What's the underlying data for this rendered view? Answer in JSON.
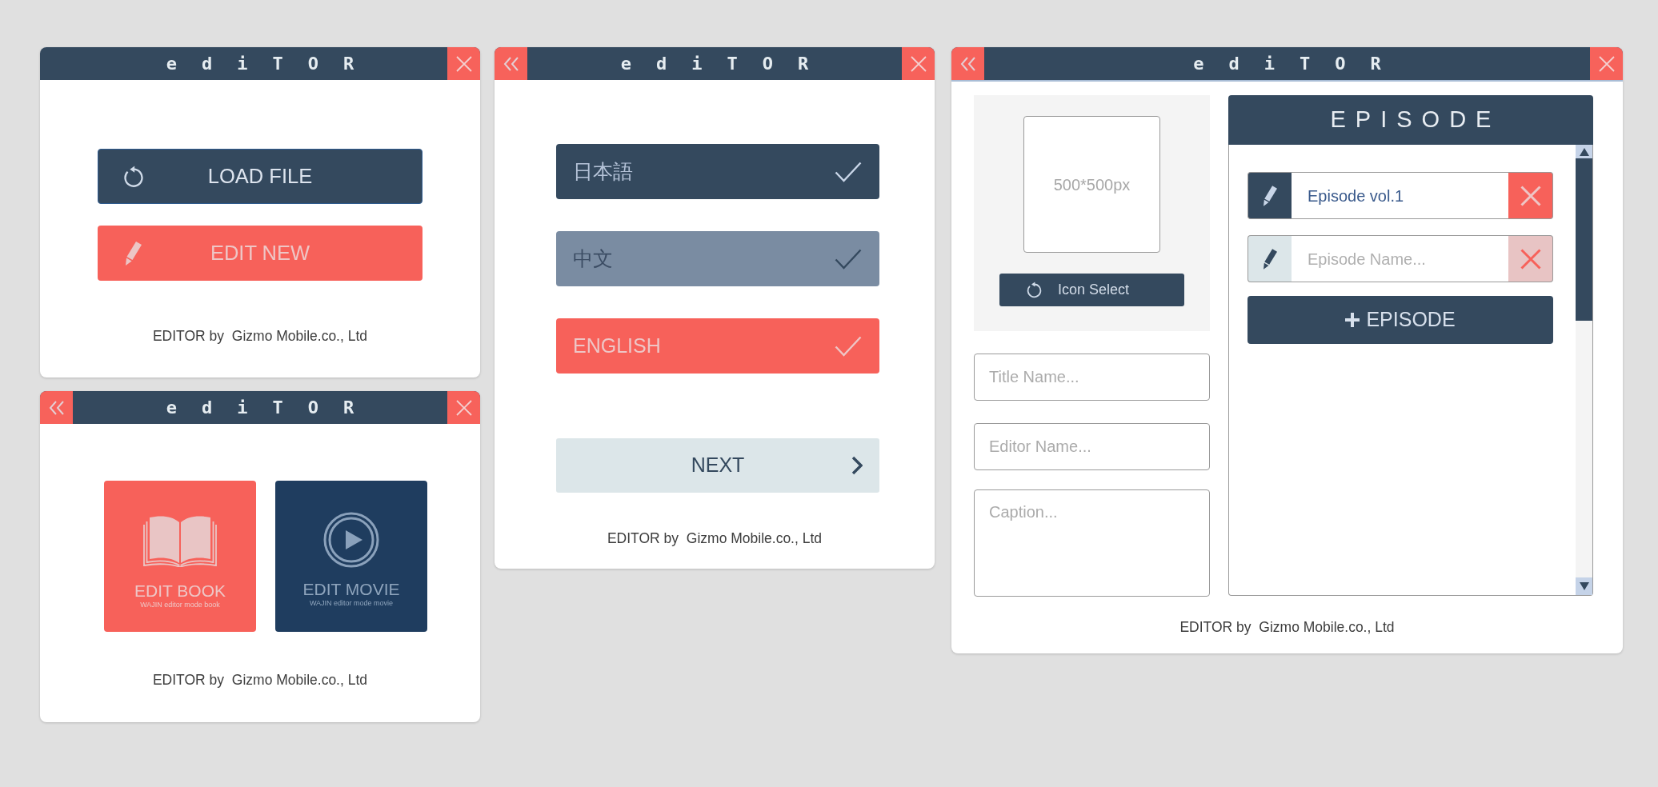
{
  "screens": [
    {
      "kind": "start",
      "title": "ediTOR",
      "back_button": false,
      "close_button": true,
      "actions": [
        {
          "label": "LOAD FILE",
          "kind": "load"
        },
        {
          "label": "EDIT NEW",
          "kind": "new"
        }
      ],
      "footer": "EDITOR by  Gizmo Mobile.co., Ltd"
    },
    {
      "kind": "mode",
      "title": "ediTOR",
      "back_button": true,
      "close_button": true,
      "modes": [
        {
          "label": "EDIT BOOK",
          "caption": "WAJIN editor mode book",
          "kind": "book"
        },
        {
          "label": "EDIT MOVIE",
          "caption": "WAJIN editor mode movie",
          "kind": "movie"
        }
      ],
      "footer": "EDITOR by  Gizmo Mobile.co., Ltd"
    },
    {
      "kind": "language",
      "title": "ediTOR",
      "back_button": true,
      "close_button": true,
      "languages": [
        {
          "label": "日本語",
          "selected": false,
          "disabled": false
        },
        {
          "label": "中文",
          "selected": false,
          "disabled": true
        },
        {
          "label": "ENGLISH",
          "selected": true,
          "disabled": false
        }
      ],
      "next_button": "NEXT",
      "footer": "EDITOR by  Gizmo Mobile.co., Ltd"
    },
    {
      "kind": "details",
      "title": "ediTOR",
      "back_button": true,
      "close_button": true,
      "icon_picker": {
        "size_hint": "500*500px",
        "button": "Icon Select"
      },
      "fields": [
        {
          "kind": "input",
          "placeholder": "Title Name..."
        },
        {
          "kind": "input",
          "placeholder": "Editor Name..."
        },
        {
          "kind": "textarea",
          "placeholder": "Caption..."
        }
      ],
      "episodes": {
        "title": "EPISODE",
        "items": [
          {
            "value": "Episode vol.1",
            "active": true
          },
          {
            "placeholder": "Episode Name...",
            "active": false
          }
        ],
        "add_button": "EPISODE"
      },
      "footer": "EDITOR by  Gizmo Mobile.co., Ltd"
    }
  ]
}
